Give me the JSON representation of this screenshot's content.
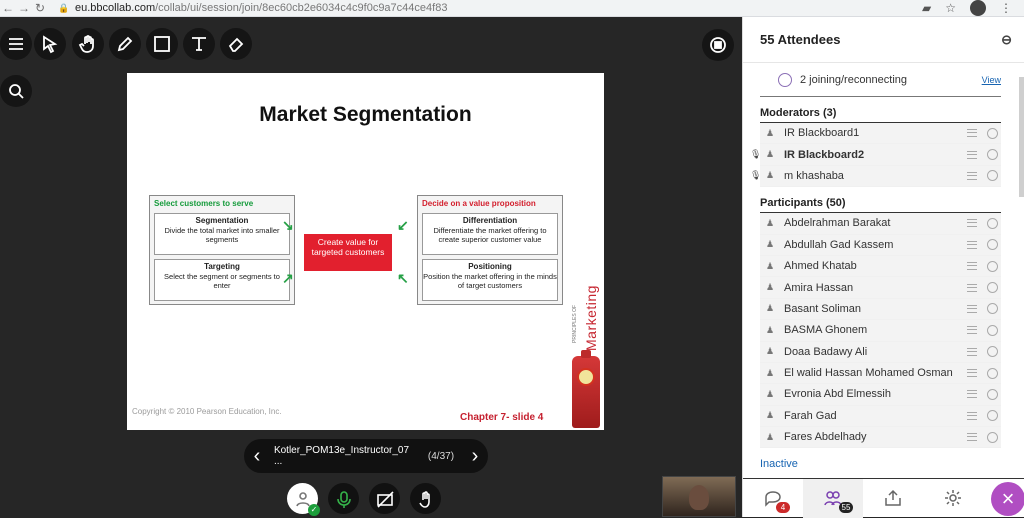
{
  "browser": {
    "url_host": "eu.bbcollab.com",
    "url_path": "/collab/ui/session/join/8ec60cb2e6034c4c9f0c9a7c44ce4f83"
  },
  "stage": {
    "slide": {
      "title": "Market Segmentation",
      "left_header": "Select customers to serve",
      "left_card_1_title": "Segmentation",
      "left_card_1_text": "Divide the total market into smaller segments",
      "left_card_2_title": "Targeting",
      "left_card_2_text": "Select the segment or segments to enter",
      "center_text": "Create value for targeted customers",
      "right_header": "Decide on a value proposition",
      "right_card_1_title": "Differentiation",
      "right_card_1_text": "Differentiate the market offering to create superior customer value",
      "right_card_2_title": "Positioning",
      "right_card_2_text": "Position the market offering in the minds of target customers",
      "copyright": "Copyright © 2010 Pearson Education, Inc.",
      "chapter": "Chapter 7- slide 4",
      "brand_small": "PRINCIPLES OF",
      "brand_big": "Marketing"
    },
    "slide_nav": {
      "title": "Kotler_POM13e_Instructor_07 ...",
      "count": "(4/37)"
    }
  },
  "side": {
    "header": "55 Attendees",
    "joining_text": "2 joining/reconnecting",
    "view_link": "View",
    "moderators_title": "Moderators (3)",
    "moderators": [
      "IR Blackboard1",
      "IR Blackboard2",
      "m khashaba"
    ],
    "participants_title": "Participants (50)",
    "participants": [
      "Abdelrahman Barakat",
      "Abdullah Gad Kassem",
      "Ahmed Khatab",
      "Amira Hassan",
      "Basant Soliman",
      "BASMA Ghonem",
      "Doaa Badawy Ali",
      "El walid Hassan Mohamed Osman",
      "Evronia Abd Elmessih",
      "Farah Gad",
      "Fares Abdelhady"
    ],
    "inactive_label": "Inactive",
    "chat_badge": "4",
    "attendees_badge": "55"
  }
}
